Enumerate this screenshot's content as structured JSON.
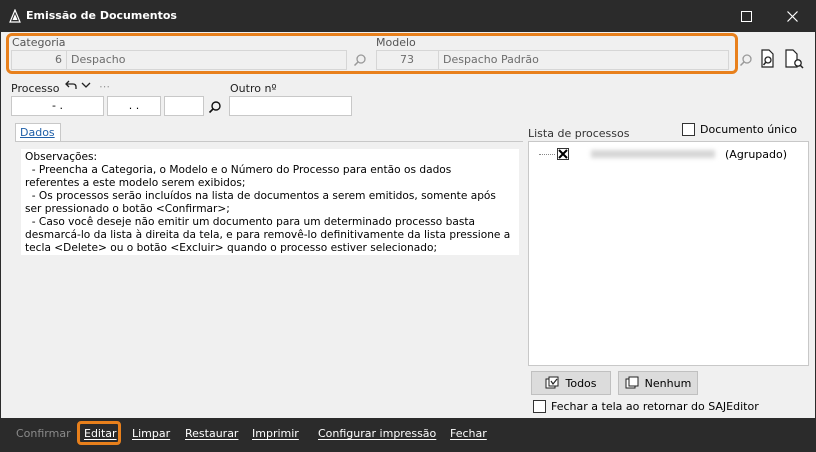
{
  "window": {
    "title": "Emissão de Documentos",
    "accent_color": "#e8801c"
  },
  "header": {
    "categoria_label": "Categoria",
    "categoria_code": "6",
    "categoria_name": "Despacho",
    "modelo_label": "Modelo",
    "modelo_code": "73",
    "modelo_name": "Despacho Padrão"
  },
  "processo": {
    "label": "Processo",
    "part1": "- .",
    "part2": ". .",
    "part3": "",
    "outro_label": "Outro nº",
    "outro_value": ""
  },
  "tabs": [
    {
      "label": "Dados"
    }
  ],
  "observacoes": "Observações:\n  - Preencha a Categoria, o Modelo e o Número do Processo para então os dados\nreferentes a este modelo serem exibidos;\n  - Os processos serão incluídos na lista de documentos a serem emitidos, somente após\nser pressionado o botão <Confirmar>;\n  - Caso você deseje não emitir um documento para um determinado processo basta\ndesmarcá-lo da lista à direita da tela, e para removê-lo definitivamente da lista pressione a\ntecla <Delete> ou o botão <Excluir> quando o processo estiver selecionado;",
  "process_list": {
    "label": "Lista de processos",
    "documento_unico_label": "Documento único",
    "items": [
      {
        "suffix": "(Agrupado)"
      }
    ]
  },
  "buttons": {
    "todos": "Todos",
    "nenhum": "Nenhum"
  },
  "fechar_option": "Fechar a tela ao retornar do SAJEditor",
  "toolbar": {
    "confirmar": "Confirmar",
    "editar": "Editar",
    "limpar": "Limpar",
    "restaurar": "Restaurar",
    "imprimir": "Imprimir",
    "configurar": "Configurar impressão",
    "fechar": "Fechar"
  }
}
